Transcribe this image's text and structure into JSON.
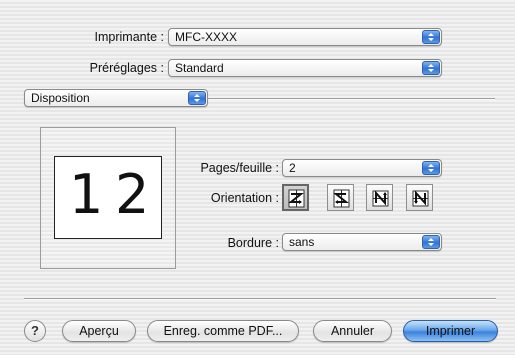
{
  "printer": {
    "label": "Imprimante :",
    "value": "MFC-XXXX"
  },
  "presets": {
    "label": "Préréglages :",
    "value": "Standard"
  },
  "panel": {
    "value": "Disposition"
  },
  "preview": {
    "left_num": "1",
    "right_num": "2"
  },
  "pages_per_sheet": {
    "label": "Pages/feuille :",
    "value": "2"
  },
  "orientation": {
    "label": "Orientation :",
    "options": [
      "z-left-to-right",
      "s-reverse",
      "n-reverse",
      "n-top-to-bottom"
    ],
    "selected_index": 0
  },
  "border": {
    "label": "Bordure :",
    "value": "sans"
  },
  "buttons": {
    "help": "?",
    "preview": "Aperçu",
    "save_pdf": "Enreg. comme PDF...",
    "cancel": "Annuler",
    "print": "Imprimer"
  },
  "colors": {
    "accent": "#3a82dc",
    "default_button": "#6aa8ea"
  }
}
